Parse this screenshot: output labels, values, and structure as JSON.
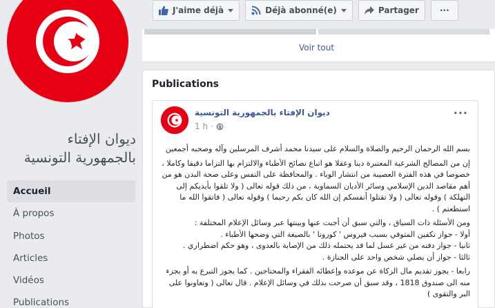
{
  "page": {
    "name": "ديوان الإفتاء بالجمهورية التونسية",
    "flag_colors": {
      "red": "#e70013",
      "white": "#ffffff"
    }
  },
  "nav": {
    "items": [
      {
        "label": "Accueil",
        "active": true
      },
      {
        "label": "À propos",
        "active": false
      },
      {
        "label": "Photos",
        "active": false
      },
      {
        "label": "Articles",
        "active": false
      },
      {
        "label": "Vidéos",
        "active": false
      },
      {
        "label": "Publications",
        "active": false
      }
    ]
  },
  "toolbar": {
    "like_label": "J'aime déjà",
    "follow_label": "Déjà abonné(e)",
    "share_label": "Partager",
    "more_label": "···"
  },
  "photos": {
    "see_all_label": "Voir tout"
  },
  "publications": {
    "title": "Publications",
    "post": {
      "author": "ديوان الإفتاء بالجمهورية التونسية",
      "time": "1 h",
      "more": "···",
      "paragraphs": [
        "بسم الله الرحمان الرحيم والصلاة والسلام على سيدنا محمد أشرف المرسلين وآله وصحبه أجمعين",
        "إن من المصالح الشرعية المعتبرة دينا وعقلا هو اتباع نصائح الأطباء والالتزام بها التزاما دقيقا وكاملا ، خصوصا في هذه الفترة العصيبة من انتشار الوباء . والمحافظة على النفس وعلى صحة البدن هو من أهم مقاصد الدين الإسلامي وسائر الأديان السماوية ، من ذلك قوله تعالى ( ولا تلقوا بأيديكم إلى التهلكة ) وقوله تعالى ( ولا تقتلوا أنفسكم إن الله كان بكم رحيما ) وقوله تعالى ( فاتقوا الله ما استطعتم ) .",
        "ومن الأسئلة ذات السياق ، والتي سبق أن أجبت عنها وبينتها عبر وسائل الإعلام المختلفة :",
        "أولا - جواز تكفين المتوفي بسبب فيروس ' كورونا ' بالصيغة التي وضحها الأطباء .",
        "ثانيا - جواز دفنه من غير غسل لما قد يحتمله ذلك من الإصابة بالعدوى ، وهو حكم اضطراري .",
        "ثالثا - جواز أن يصلي شخص واحد على الجنازة .",
        "رابعا - يجوز تقديم مال الزكاة عن موعده وإعطائه الفقراء والمحتاجين . كما يجوز التبرع به أو بجزء منه الى صندوق 1818 ، وقد سبق أن صرحت بذلك في وسائل الإعلام . قال تعالى ( وتعاونوا على البر والتقوى )"
      ]
    }
  }
}
